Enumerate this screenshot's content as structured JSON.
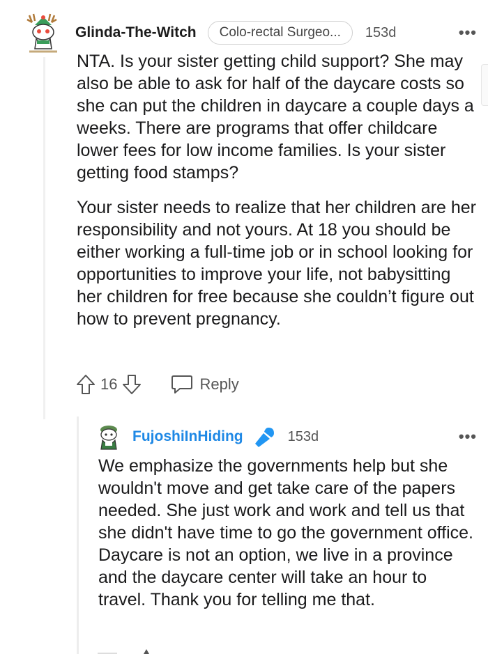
{
  "comment": {
    "username": "Glinda-The-Witch",
    "flair": "Colo-rectal Surgeo...",
    "age": "153d",
    "more": "•••",
    "paragraphs": [
      "NTA. Is your sister getting child support? She may also be able to ask for half of the daycare costs so she can put the children in daycare a couple days a weeks. There are programs that offer childcare lower fees for low income families. Is your sister getting food stamps?",
      "Your sister needs to realize that her children are her responsibility and not yours. At 18 you should be either working a full-time job or in school looking for opportunities to improve your life, not babysitting her children for free because she couldn’t figure out how to prevent pregnancy."
    ],
    "votes": "16",
    "reply_label": "Reply"
  },
  "reply": {
    "username": "FujoshiInHiding",
    "age": "153d",
    "more": "•••",
    "text": "We emphasize the governments help but she wouldn't move and get take care of the papers needed. She just work and work and tell us that she didn't have time to go the government office. Daycare is not an option, we live in a province and the daycare center will take an hour to travel. Thank you for telling me that."
  },
  "colors": {
    "username_reply": "#1e88e5",
    "mic_icon": "#2196f3",
    "meta_text": "#555555"
  }
}
